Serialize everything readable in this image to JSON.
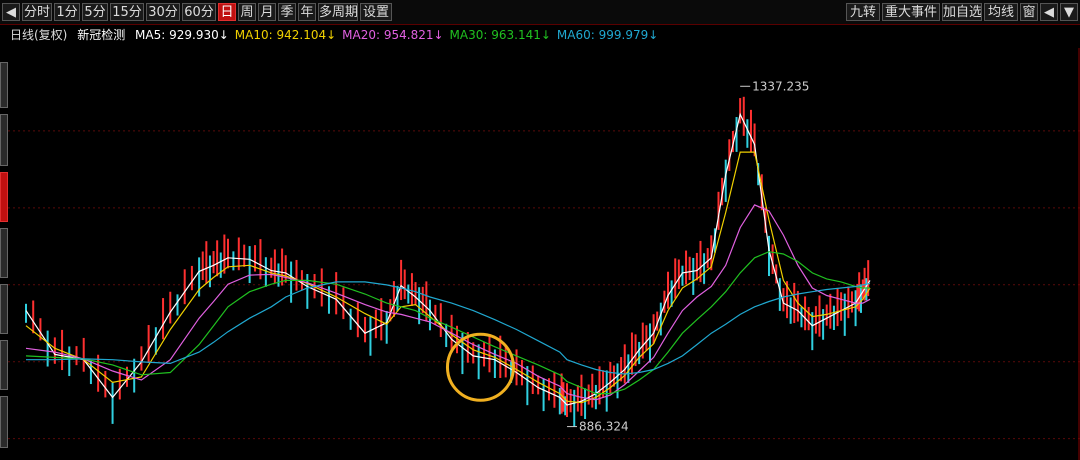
{
  "toolbar": {
    "left_buttons": [
      "◀",
      "分时",
      "1分",
      "5分",
      "15分",
      "30分",
      "60分",
      "日",
      "周",
      "月",
      "季",
      "年",
      "多周期",
      "设置"
    ],
    "active_index": 7,
    "right_buttons": [
      "九转",
      "重大事件",
      "加自选",
      "均线",
      "窗",
      "◀",
      "▼"
    ]
  },
  "legend": {
    "period": "日线(复权)",
    "name": "新冠检测",
    "items": [
      {
        "label": "MA5: 929.930",
        "arrow": "↓",
        "color": "#ffffff"
      },
      {
        "label": "MA10: 942.104",
        "arrow": "↓",
        "color": "#f0d000"
      },
      {
        "label": "MA20: 954.821",
        "arrow": "↓",
        "color": "#e060e0"
      },
      {
        "label": "MA30: 963.141",
        "arrow": "↓",
        "color": "#20c020"
      },
      {
        "label": "MA60: 999.979",
        "arrow": "↓",
        "color": "#20a8d0"
      }
    ]
  },
  "colors": {
    "up": "#ff3030",
    "down": "#30d0e0",
    "grid": "#5a0a0a",
    "highlight_circle": "#f0b020"
  },
  "chart_data": {
    "type": "line",
    "title": "新冠检测 日线(复权)",
    "ylim": [
      850,
      1380
    ],
    "grid": true,
    "annotations": [
      {
        "label": "1337.235",
        "x": 198,
        "y": 1337.235,
        "kind": "high"
      },
      {
        "label": "886.324",
        "x": 150,
        "y": 886.324,
        "kind": "low"
      }
    ],
    "highlight": {
      "x": 126,
      "y": 965,
      "shape": "circle"
    },
    "x": [
      0,
      8,
      16,
      24,
      32,
      40,
      48,
      52,
      56,
      62,
      68,
      72,
      78,
      86,
      94,
      100,
      104,
      108,
      112,
      118,
      124,
      130,
      136,
      142,
      148,
      150,
      154,
      158,
      162,
      166,
      170,
      174,
      178,
      182,
      186,
      190,
      194,
      198,
      202,
      206,
      210,
      214,
      218,
      222,
      226,
      230,
      232,
      234
    ],
    "series": [
      {
        "name": "MA5",
        "color": "#ffffff",
        "values": [
          1040,
          982,
          975,
          925,
          972,
          1038,
          1092,
          1100,
          1110,
          1108,
          1093,
          1090,
          1072,
          1055,
          1010,
          1024,
          1073,
          1058,
          1040,
          1002,
          980,
          975,
          958,
          938,
          925,
          915,
          920,
          930,
          945,
          962,
          988,
          1010,
          1060,
          1090,
          1093,
          1110,
          1220,
          1300,
          1260,
          1120,
          1050,
          1040,
          1020,
          1030,
          1040,
          1050,
          1065,
          1080
        ]
      },
      {
        "name": "MA10",
        "color": "#f0d000",
        "values": [
          1020,
          990,
          975,
          945,
          952,
          1015,
          1068,
          1084,
          1098,
          1100,
          1090,
          1086,
          1076,
          1058,
          1036,
          1022,
          1045,
          1048,
          1032,
          1008,
          988,
          978,
          962,
          945,
          930,
          920,
          918,
          925,
          938,
          954,
          978,
          996,
          1040,
          1070,
          1082,
          1098,
          1170,
          1250,
          1250,
          1160,
          1080,
          1050,
          1032,
          1035,
          1040,
          1045,
          1055,
          1070
        ]
      },
      {
        "name": "MA20",
        "color": "#e060e0",
        "values": [
          990,
          985,
          976,
          960,
          948,
          975,
          1030,
          1052,
          1075,
          1087,
          1088,
          1084,
          1077,
          1063,
          1048,
          1038,
          1035,
          1030,
          1025,
          1010,
          995,
          982,
          970,
          953,
          940,
          930,
          925,
          922,
          928,
          942,
          960,
          978,
          1010,
          1040,
          1058,
          1072,
          1100,
          1150,
          1180,
          1172,
          1140,
          1100,
          1070,
          1060,
          1055,
          1050,
          1050,
          1055
        ]
      },
      {
        "name": "MA30",
        "color": "#20c020",
        "values": [
          980,
          978,
          976,
          968,
          955,
          958,
          995,
          1020,
          1045,
          1065,
          1075,
          1080,
          1080,
          1075,
          1062,
          1050,
          1045,
          1040,
          1030,
          1018,
          1005,
          992,
          980,
          968,
          955,
          946,
          938,
          930,
          930,
          936,
          948,
          962,
          985,
          1010,
          1028,
          1045,
          1065,
          1090,
          1110,
          1118,
          1115,
          1105,
          1090,
          1082,
          1078,
          1072,
          1070,
          1070
        ]
      },
      {
        "name": "MA60",
        "color": "#20a8d0",
        "values": [
          975,
          975,
          976,
          975,
          972,
          970,
          985,
          998,
          1012,
          1030,
          1045,
          1058,
          1070,
          1078,
          1078,
          1074,
          1070,
          1065,
          1058,
          1050,
          1040,
          1028,
          1015,
          1000,
          985,
          975,
          968,
          962,
          958,
          956,
          958,
          962,
          970,
          980,
          995,
          1010,
          1022,
          1035,
          1045,
          1052,
          1058,
          1062,
          1065,
          1068,
          1070,
          1072,
          1074,
          1076
        ]
      }
    ]
  }
}
